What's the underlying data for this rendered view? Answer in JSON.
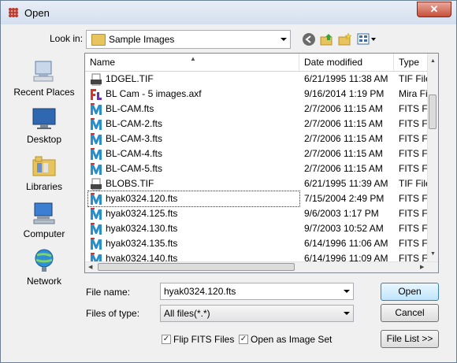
{
  "window": {
    "title": "Open",
    "close": "✕"
  },
  "lookin": {
    "label": "Look in:",
    "value": "Sample Images"
  },
  "places": [
    {
      "label": "Recent Places",
      "icon": "recent-places-icon"
    },
    {
      "label": "Desktop",
      "icon": "desktop-icon"
    },
    {
      "label": "Libraries",
      "icon": "libraries-icon"
    },
    {
      "label": "Computer",
      "icon": "computer-icon"
    },
    {
      "label": "Network",
      "icon": "network-icon"
    }
  ],
  "columns": {
    "name": "Name",
    "date": "Date modified",
    "type": "Type"
  },
  "files": [
    {
      "name": "1DGEL.TIF",
      "date": "6/21/1995 11:38 AM",
      "type": "TIF File",
      "icon": "tif"
    },
    {
      "name": "BL Cam - 5 images.axf",
      "date": "9/16/2014 1:19 PM",
      "type": "Mira Fi",
      "icon": "axf"
    },
    {
      "name": "BL-CAM.fts",
      "date": "2/7/2006 11:15 AM",
      "type": "FITS Fi",
      "icon": "fits"
    },
    {
      "name": "BL-CAM-2.fts",
      "date": "2/7/2006 11:15 AM",
      "type": "FITS Fi",
      "icon": "fits"
    },
    {
      "name": "BL-CAM-3.fts",
      "date": "2/7/2006 11:15 AM",
      "type": "FITS Fi",
      "icon": "fits"
    },
    {
      "name": "BL-CAM-4.fts",
      "date": "2/7/2006 11:15 AM",
      "type": "FITS Fi",
      "icon": "fits"
    },
    {
      "name": "BL-CAM-5.fts",
      "date": "2/7/2006 11:15 AM",
      "type": "FITS Fi",
      "icon": "fits"
    },
    {
      "name": "BLOBS.TIF",
      "date": "6/21/1995 11:39 AM",
      "type": "TIF File",
      "icon": "tif"
    },
    {
      "name": "hyak0324.120.fts",
      "date": "7/15/2004 2:49 PM",
      "type": "FITS Fi",
      "icon": "fits",
      "selected": true
    },
    {
      "name": "hyak0324.125.fts",
      "date": "9/6/2003 1:17 PM",
      "type": "FITS Fi",
      "icon": "fits"
    },
    {
      "name": "hyak0324.130.fts",
      "date": "9/7/2003 10:52 AM",
      "type": "FITS Fi",
      "icon": "fits"
    },
    {
      "name": "hyak0324.135.fts",
      "date": "6/14/1996 11:06 AM",
      "type": "FITS Fi",
      "icon": "fits"
    },
    {
      "name": "hyak0324.140.fts",
      "date": "6/14/1996 11:09 AM",
      "type": "FITS Fi",
      "icon": "fits"
    }
  ],
  "filename": {
    "label": "File name:",
    "value": "hyak0324.120.fts"
  },
  "filetype": {
    "label": "Files of type:",
    "value": "All files(*.*)"
  },
  "buttons": {
    "open": "Open",
    "cancel": "Cancel",
    "filelist": "File List  >>"
  },
  "checks": {
    "flip": "Flip FITS Files",
    "imageset": "Open as Image Set"
  },
  "colors": {
    "accent": "#3c7fb1",
    "selection_border": "#333333",
    "fits_icon": "#2a8fc9",
    "fits_icon_red": "#d9342b"
  }
}
